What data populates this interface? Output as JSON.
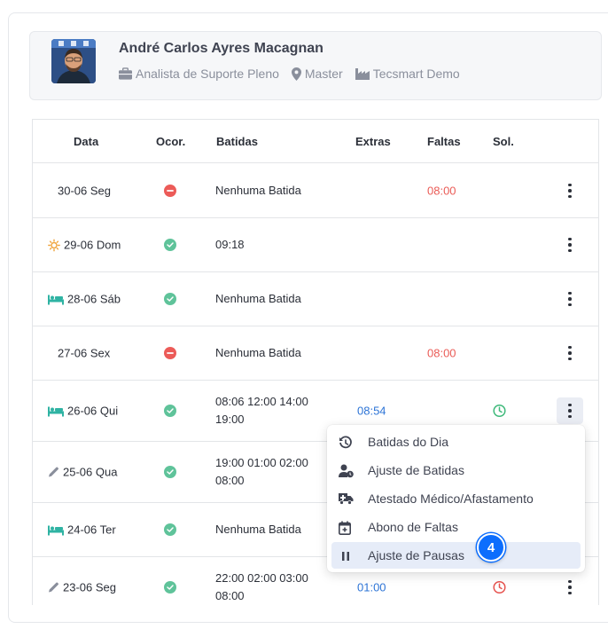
{
  "profile": {
    "name": "André Carlos Ayres Macagnan",
    "role": "Analista de Suporte Pleno",
    "location": "Master",
    "company": "Tecsmart Demo"
  },
  "table": {
    "headers": [
      "Data",
      "Ocor.",
      "Batidas",
      "Extras",
      "Faltas",
      "Sol."
    ],
    "rows": [
      {
        "date": "30-06 Seg",
        "day_icon": "",
        "status": "error",
        "batidas": "Nenhuma Batida",
        "extras": "",
        "faltas": "08:00",
        "sol": ""
      },
      {
        "date": "29-06 Dom",
        "day_icon": "sun-icon",
        "status": "ok",
        "batidas": "09:18",
        "extras": "",
        "faltas": "",
        "sol": ""
      },
      {
        "date": "28-06 Sáb",
        "day_icon": "bed-icon",
        "status": "ok",
        "batidas": "Nenhuma Batida",
        "extras": "",
        "faltas": "",
        "sol": ""
      },
      {
        "date": "27-06 Sex",
        "day_icon": "",
        "status": "error",
        "batidas": "Nenhuma Batida",
        "extras": "",
        "faltas": "08:00",
        "sol": ""
      },
      {
        "date": "26-06 Qui",
        "day_icon": "bed-icon",
        "status": "ok",
        "batidas": "08:06 12:00 14:00 19:00",
        "extras": "08:54",
        "faltas": "",
        "sol": "clock-green-icon"
      },
      {
        "date": "25-06 Qua",
        "day_icon": "pencil-icon",
        "status": "ok",
        "batidas": "19:00 01:00 02:00 08:00",
        "extras": "",
        "faltas": "",
        "sol": ""
      },
      {
        "date": "24-06 Ter",
        "day_icon": "bed-icon",
        "status": "ok",
        "batidas": "Nenhuma Batida",
        "extras": "",
        "faltas": "",
        "sol": ""
      },
      {
        "date": "23-06 Seg",
        "day_icon": "pencil-icon",
        "status": "ok",
        "batidas": "22:00 02:00 03:00 08:00",
        "extras": "01:00",
        "faltas": "",
        "sol": "clock-red-icon"
      }
    ]
  },
  "menu": {
    "items": [
      {
        "label": "Batidas do Dia",
        "icon": "history-icon"
      },
      {
        "label": "Ajuste de Batidas",
        "icon": "user-clock-icon"
      },
      {
        "label": "Atestado Médico/Afastamento",
        "icon": "ambulance-icon"
      },
      {
        "label": "Abono de Faltas",
        "icon": "calendar-plus-icon"
      },
      {
        "label": "Ajuste de Pausas",
        "icon": "pause-icon"
      }
    ]
  },
  "step_badge": "4",
  "colors": {
    "ok": "#5fc39a",
    "error": "#ec5b58",
    "extra": "#2d74d6",
    "accent": "#0d6efd"
  }
}
